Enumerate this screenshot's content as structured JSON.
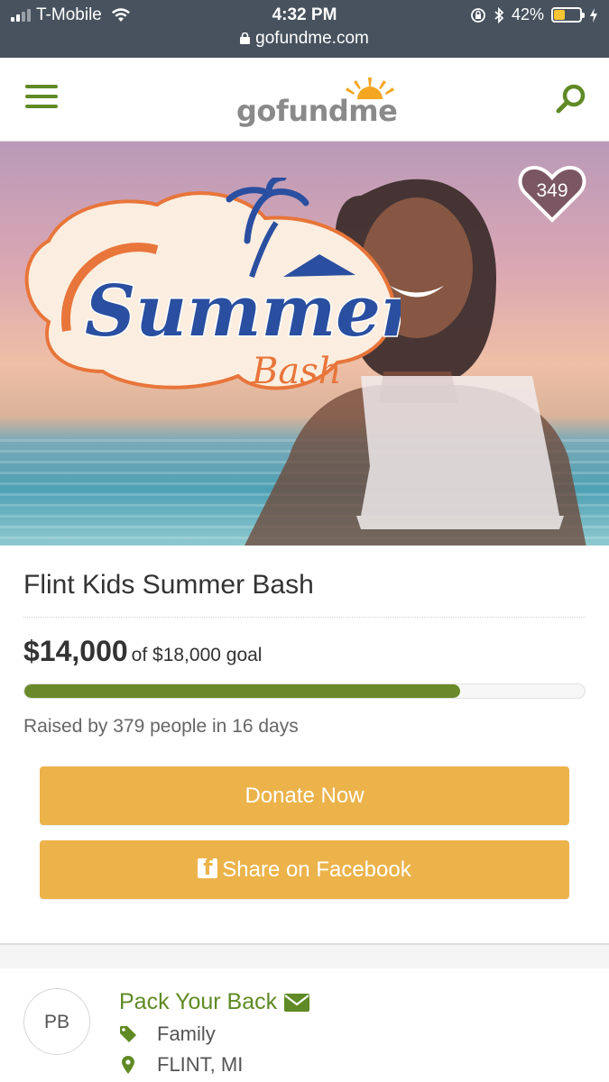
{
  "status_bar": {
    "carrier": "T-Mobile",
    "time": "4:32 PM",
    "battery": "42%",
    "url": "gofundme.com"
  },
  "header": {
    "logo_text": "gofundme",
    "menu_icon": "hamburger-menu-icon",
    "search_icon": "search-icon"
  },
  "hero": {
    "logo_line1": "Summer",
    "logo_line2": "Bash",
    "hearts": "349"
  },
  "campaign": {
    "title": "Flint Kids Summer Bash",
    "raised": "$14,000",
    "goal": "of $18,000 goal",
    "progress_fraction": 0.778,
    "raised_by": "Raised by 379 people in 16 days"
  },
  "buttons": {
    "donate": "Donate Now",
    "share": "Share on Facebook"
  },
  "organizer": {
    "initials": "PB",
    "name": "Pack Your Back",
    "category": "Family",
    "location": "FLINT, MI"
  },
  "colors": {
    "brand_green": "#5f8a25",
    "progress_green": "#6a8a2a",
    "button_yellow": "#ecb34a",
    "status_bar": "#47525e"
  }
}
